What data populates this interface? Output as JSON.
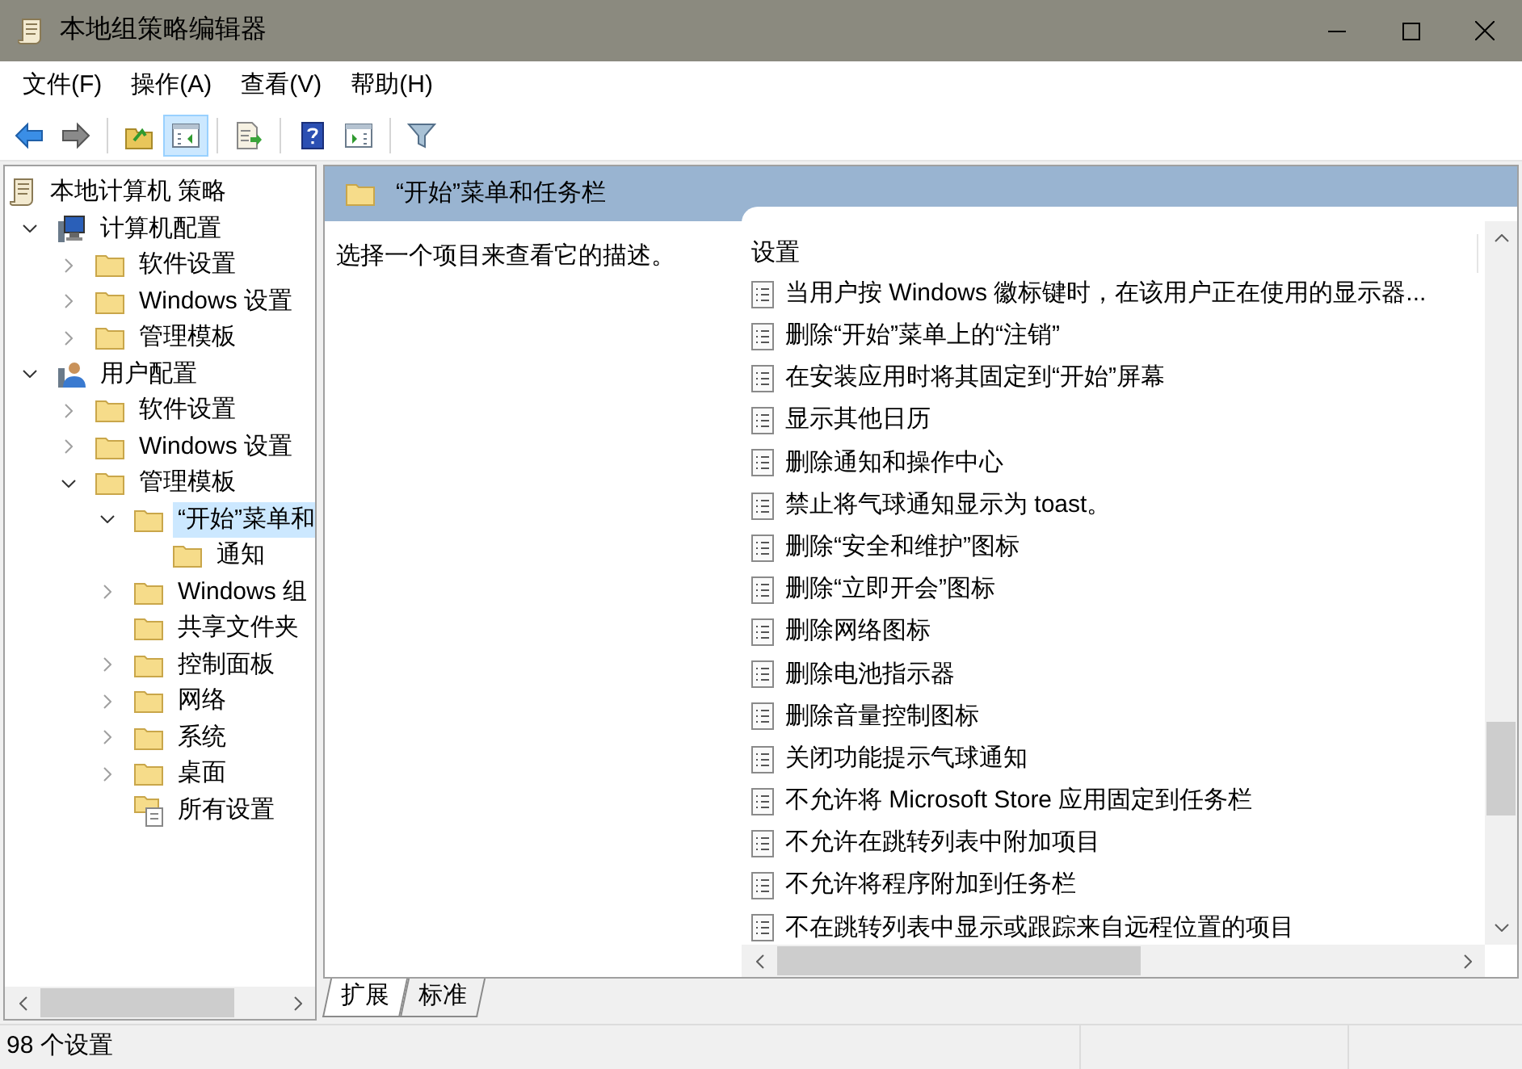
{
  "window": {
    "title": "本地组策略编辑器"
  },
  "menu": [
    "文件(F)",
    "操作(A)",
    "查看(V)",
    "帮助(H)"
  ],
  "toolbar": [
    {
      "kind": "back",
      "selected": false
    },
    {
      "kind": "forward",
      "selected": false
    },
    {
      "kind": "up",
      "selected": false
    },
    {
      "kind": "tree",
      "selected": true
    },
    {
      "kind": "export",
      "selected": false
    },
    {
      "kind": "help",
      "selected": false
    },
    {
      "kind": "action",
      "selected": false
    },
    {
      "kind": "filter",
      "selected": false
    }
  ],
  "tree": [
    {
      "label": "本地计算机 策略",
      "kind": "policy",
      "selected": false,
      "children": [
        {
          "label": "计算机配置",
          "kind": "computer",
          "expanded": true,
          "selected": false,
          "children": [
            {
              "label": "软件设置",
              "kind": "folder",
              "expanded": false,
              "selected": false
            },
            {
              "label": "Windows 设置",
              "kind": "folder",
              "expanded": false,
              "selected": false
            },
            {
              "label": "管理模板",
              "kind": "folder",
              "expanded": false,
              "selected": false
            }
          ]
        },
        {
          "label": "用户配置",
          "kind": "user",
          "expanded": true,
          "selected": false,
          "children": [
            {
              "label": "软件设置",
              "kind": "folder",
              "expanded": false,
              "selected": false
            },
            {
              "label": "Windows 设置",
              "kind": "folder",
              "expanded": false,
              "selected": false
            },
            {
              "label": "管理模板",
              "kind": "folder",
              "expanded": true,
              "selected": false,
              "children": [
                {
                  "label": "“开始”菜单和",
                  "kind": "folder",
                  "expanded": true,
                  "selected": true,
                  "children": [
                    {
                      "label": "通知",
                      "kind": "folder",
                      "selected": false
                    }
                  ]
                },
                {
                  "label": "Windows 组",
                  "kind": "folder",
                  "expanded": false,
                  "selected": false
                },
                {
                  "label": "共享文件夹",
                  "kind": "folder",
                  "selected": false
                },
                {
                  "label": "控制面板",
                  "kind": "folder",
                  "expanded": false,
                  "selected": false
                },
                {
                  "label": "网络",
                  "kind": "folder",
                  "expanded": false,
                  "selected": false
                },
                {
                  "label": "系统",
                  "kind": "folder",
                  "expanded": false,
                  "selected": false
                },
                {
                  "label": "桌面",
                  "kind": "folder",
                  "expanded": false,
                  "selected": false
                },
                {
                  "label": "所有设置",
                  "kind": "settings",
                  "selected": false
                }
              ]
            }
          ]
        }
      ]
    }
  ],
  "panel": {
    "title": "“开始”菜单和任务栏",
    "description": "选择一个项目来查看它的描述。",
    "column": "设置",
    "settings": [
      "当用户按 Windows 徽标键时，在该用户正在使用的显示器...",
      "删除“开始”菜单上的“注销”",
      "在安装应用时将其固定到“开始”屏幕",
      "显示其他日历",
      "删除通知和操作中心",
      "禁止将气球通知显示为 toast。",
      "删除“安全和维护”图标",
      "删除“立即开会”图标",
      "删除网络图标",
      "删除电池指示器",
      "删除音量控制图标",
      "关闭功能提示气球通知",
      "不允许将 Microsoft Store 应用固定到任务栏",
      "不允许在跳转列表中附加项目",
      "不允许将程序附加到任务栏",
      "不在跳转列表中显示或跟踪来自远程位置的项目"
    ]
  },
  "tabs": [
    {
      "label": "扩展",
      "selected": true
    },
    {
      "label": "标准",
      "selected": false
    }
  ],
  "status_bar": "98 个设置"
}
